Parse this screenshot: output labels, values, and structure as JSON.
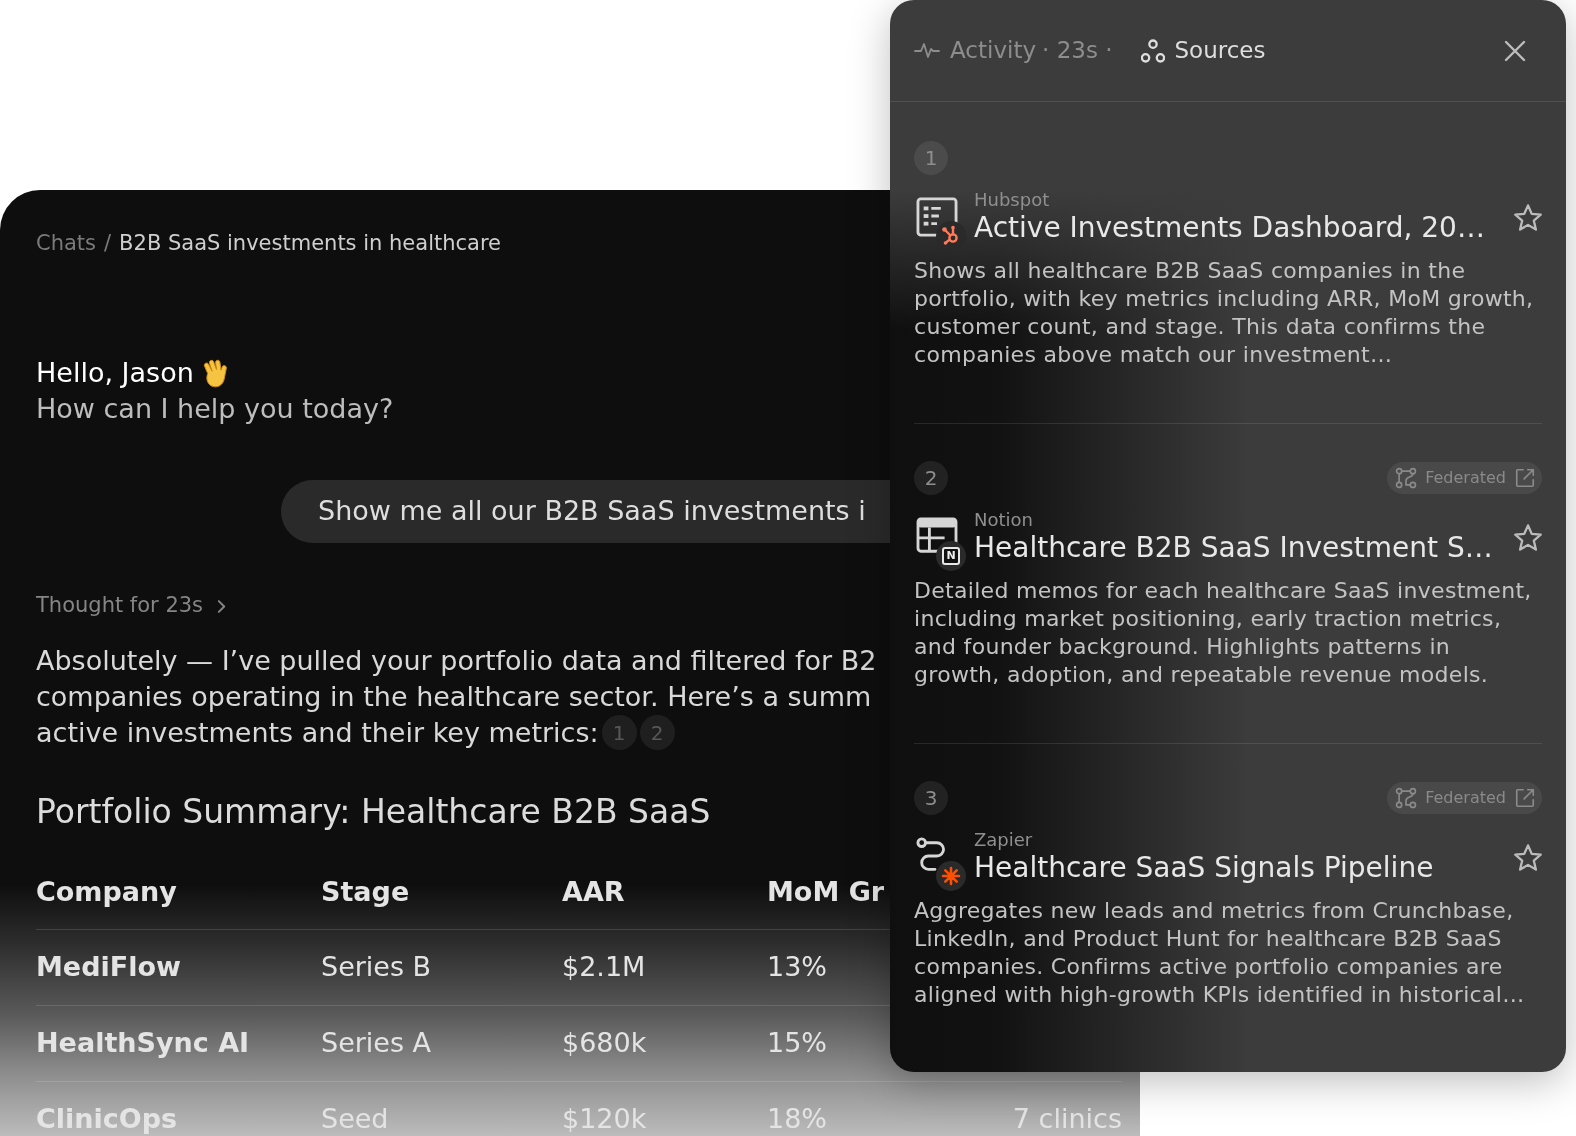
{
  "chat": {
    "breadcrumb": {
      "items": [
        "Chats",
        "B2B SaaS investments in healthcare"
      ],
      "separator": "/"
    },
    "greeting": "Hello, Jason",
    "subtitle": "How can I help you today?",
    "user_message": "Show me all our B2B SaaS investments i",
    "thought": {
      "label": "Thought for 23s",
      "expanded": false
    },
    "response_lines": [
      "Absolutely — I’ve pulled your portfolio data and filtered for B2",
      "companies operating in the healthcare sector. Here’s a summ",
      "active investments and their key metrics:"
    ],
    "citations": [
      "1",
      "2"
    ],
    "heading": "Portfolio Summary: Healthcare B2B SaaS",
    "table": {
      "columns": [
        "Company",
        "Stage",
        "AAR",
        "MoM Gr"
      ],
      "rows": [
        [
          "MediFlow",
          "Series B",
          "$2.1M",
          "13%"
        ],
        [
          "HealthSync AI",
          "Series A",
          "$680k",
          "15%"
        ],
        [
          "ClinicOps",
          "Seed",
          "$120k",
          "18%",
          "7 clinics"
        ]
      ]
    }
  },
  "sources_panel": {
    "tabs": [
      {
        "label": "Activity",
        "meta": "· 23s ·",
        "selected": false
      },
      {
        "label": "Sources",
        "selected": true
      }
    ],
    "items": [
      {
        "number": "1",
        "kind": "dashboard",
        "source": "Hubspot",
        "title": "Active Investments Dashboard, 20…",
        "description": "Shows all healthcare B2B SaaS companies in the portfolio, with key metrics including ARR, MoM growth, customer count, and stage. This data confirms the companies above match our investment…",
        "starred": false
      },
      {
        "number": "2",
        "kind": "document",
        "badge": "N",
        "tag": "Federated",
        "source": "Notion",
        "title": "Healthcare B2B SaaS Investment S…",
        "description": "Detailed memos for each healthcare SaaS investment, including market positioning, early traction metrics, and founder background. Highlights patterns in growth, adoption, and repeatable revenue models.",
        "starred": false
      },
      {
        "number": "3",
        "kind": "workflow",
        "tag": "Federated",
        "source": "Zapier",
        "title": "Healthcare SaaS Signals Pipeline",
        "description": "Aggregates new leads and metrics from Crunchbase, LinkedIn, and Product Hunt for healthcare B2B SaaS companies. Confirms active portfolio companies are aligned with high-growth KPIs identified in historical…",
        "starred": false
      }
    ]
  }
}
